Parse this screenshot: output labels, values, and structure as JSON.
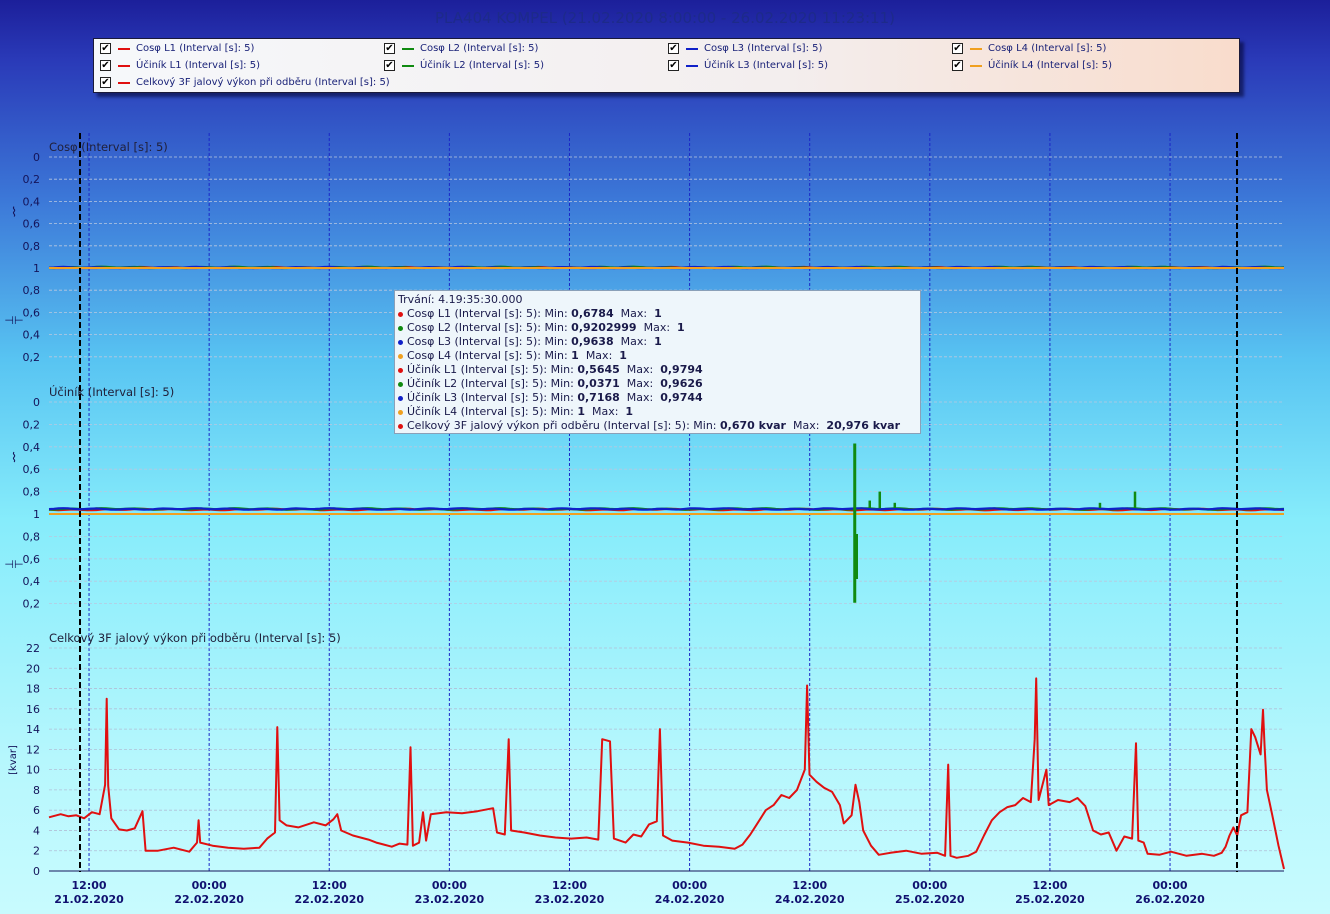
{
  "window_title": "PLA404 KOMPEL (21.02.2020 8:00:00 - 26.02.2020 11:23:11)",
  "legend": [
    {
      "label": "Cosφ L1 (Interval [s]: 5)",
      "color": "#e01010",
      "checked": "✔"
    },
    {
      "label": "Cosφ L2 (Interval [s]: 5)",
      "color": "#108a10",
      "checked": "✔"
    },
    {
      "label": "Cosφ L3 (Interval [s]: 5)",
      "color": "#1020c8",
      "checked": "✔"
    },
    {
      "label": "Cosφ L4 (Interval [s]: 5)",
      "color": "#f0a020",
      "checked": "✔"
    },
    {
      "label": "Účiník L1 (Interval [s]: 5)",
      "color": "#e01010",
      "checked": "✔"
    },
    {
      "label": "Účiník L2 (Interval [s]: 5)",
      "color": "#108a10",
      "checked": "✔"
    },
    {
      "label": "Účiník L3 (Interval [s]: 5)",
      "color": "#1020c8",
      "checked": "✔"
    },
    {
      "label": "Účiník L4 (Interval [s]: 5)",
      "color": "#f0a020",
      "checked": "✔"
    },
    {
      "label": "Celkový 3F jalový výkon při odběru (Interval [s]: 5)",
      "color": "#e01010",
      "checked": "✔"
    }
  ],
  "tooltip": {
    "duration": "Trvání: 4.19:35:30.000",
    "rows": [
      {
        "label": "Cosφ L1 (Interval [s]: 5): Min: ",
        "min": "0,6784",
        "mid": "  Max:  ",
        "max": "1",
        "color": "#e01010"
      },
      {
        "label": "Cosφ L2 (Interval [s]: 5): Min: ",
        "min": "0,9202999",
        "mid": "  Max:  ",
        "max": "1",
        "color": "#108a10"
      },
      {
        "label": "Cosφ L3 (Interval [s]: 5): Min: ",
        "min": "0,9638",
        "mid": "  Max:  ",
        "max": "1",
        "color": "#1020c8"
      },
      {
        "label": "Cosφ L4 (Interval [s]: 5): Min: ",
        "min": "1",
        "mid": "  Max:  ",
        "max": "1",
        "color": "#f0a020"
      },
      {
        "label": "Účiník L1 (Interval [s]: 5): Min: ",
        "min": "0,5645",
        "mid": "  Max:  ",
        "max": "0,9794",
        "color": "#e01010"
      },
      {
        "label": "Účiník L2 (Interval [s]: 5): Min: ",
        "min": "0,0371",
        "mid": "  Max:  ",
        "max": "0,9626",
        "color": "#108a10"
      },
      {
        "label": "Účiník L3 (Interval [s]: 5): Min: ",
        "min": "0,7168",
        "mid": "  Max:  ",
        "max": "0,9744",
        "color": "#1020c8"
      },
      {
        "label": "Účiník L4 (Interval [s]: 5): Min: ",
        "min": "1",
        "mid": "  Max:  ",
        "max": "1",
        "color": "#f0a020"
      },
      {
        "label": "Celkový 3F jalový výkon při odběru (Interval [s]: 5): Min: ",
        "min": "0,670 kvar",
        "mid": "  Max:  ",
        "max": "20,976 kvar",
        "color": "#e01010"
      }
    ]
  },
  "chart_data": [
    {
      "type": "line",
      "title": "Cosφ (Interval [s]: 5)",
      "ylabel_ind": "⌇",
      "ylabel_cap": "⊣⊢",
      "yticks_top": [
        "0",
        "0,2",
        "0,4",
        "0,6",
        "0,8",
        "1"
      ],
      "yticks_bottom": [
        "0,8",
        "0,6",
        "0,4",
        "0,2"
      ],
      "series": [
        {
          "name": "Cosφ L1 (Interval [s]: 5)",
          "color": "#e01010",
          "typical": 0.998,
          "min": 0.6784,
          "max": 1
        },
        {
          "name": "Cosφ L2 (Interval [s]: 5)",
          "color": "#108a10",
          "typical": 0.995,
          "min": 0.9202999,
          "max": 1
        },
        {
          "name": "Cosφ L3 (Interval [s]: 5)",
          "color": "#1020c8",
          "typical": 0.997,
          "min": 0.9638,
          "max": 1
        },
        {
          "name": "Cosφ L4 (Interval [s]: 5)",
          "color": "#f0a020",
          "typical": 1,
          "min": 1,
          "max": 1
        }
      ]
    },
    {
      "type": "line",
      "title": "Účiník (Interval [s]: 5)",
      "ylabel_ind": "⌇",
      "ylabel_cap": "⊣⊢",
      "yticks_top": [
        "0",
        "0,2",
        "0,4",
        "0,6",
        "0,8",
        "1"
      ],
      "yticks_bottom": [
        "0,8",
        "0,6",
        "0,4",
        "0,2"
      ],
      "series": [
        {
          "name": "Účiník L1 (Interval [s]: 5)",
          "color": "#e01010",
          "typical": 0.96,
          "min": 0.5645,
          "max": 0.9794
        },
        {
          "name": "Účiník L2 (Interval [s]: 5)",
          "color": "#108a10",
          "typical": 0.955,
          "min": 0.0371,
          "max": 0.9626
        },
        {
          "name": "Účiník L3 (Interval [s]: 5)",
          "color": "#1020c8",
          "typical": 0.955,
          "min": 0.7168,
          "max": 0.9744
        },
        {
          "name": "Účiník L4 (Interval [s]: 5)",
          "color": "#f0a020",
          "typical": 1,
          "min": 1,
          "max": 1
        }
      ]
    },
    {
      "type": "line",
      "title": "Celkový 3F jalový výkon při odběru (Interval [s]: 5)",
      "ylabel": "[kvar]",
      "ylim": [
        0,
        22
      ],
      "yticks": [
        "0",
        "2",
        "4",
        "6",
        "8",
        "10",
        "12",
        "14",
        "16",
        "18",
        "20",
        "22"
      ],
      "x_start": "21.02.2020 08:00",
      "x_end": "26.02.2020 11:23",
      "xticks": [
        {
          "time": "12:00",
          "date": "21.02.2020"
        },
        {
          "time": "00:00",
          "date": "22.02.2020"
        },
        {
          "time": "12:00",
          "date": "22.02.2020"
        },
        {
          "time": "00:00",
          "date": "23.02.2020"
        },
        {
          "time": "12:00",
          "date": "23.02.2020"
        },
        {
          "time": "00:00",
          "date": "24.02.2020"
        },
        {
          "time": "12:00",
          "date": "24.02.2020"
        },
        {
          "time": "00:00",
          "date": "25.02.2020"
        },
        {
          "time": "12:00",
          "date": "25.02.2020"
        },
        {
          "time": "00:00",
          "date": "26.02.2020"
        }
      ],
      "series": [
        {
          "name": "Celkový 3F jalový výkon při odběru (Interval [s]: 5)",
          "color": "#e01010",
          "points": [
            [
              0,
              5.3
            ],
            [
              1.5,
              5.6
            ],
            [
              2.5,
              5.4
            ],
            [
              3.5,
              5.5
            ],
            [
              4.5,
              5.2
            ],
            [
              5.5,
              5.8
            ],
            [
              6.5,
              5.6
            ],
            [
              7.2,
              8.5
            ],
            [
              7.4,
              17
            ],
            [
              7.6,
              8.4
            ],
            [
              8,
              5.2
            ],
            [
              9,
              4.1
            ],
            [
              10,
              4.0
            ],
            [
              11,
              4.2
            ],
            [
              12,
              5.9
            ],
            [
              12.4,
              2.0
            ],
            [
              14,
              2.0
            ],
            [
              16,
              2.3
            ],
            [
              18,
              1.9
            ],
            [
              19,
              2.8
            ],
            [
              19.2,
              5.0
            ],
            [
              19.4,
              2.8
            ],
            [
              21,
              2.5
            ],
            [
              23,
              2.3
            ],
            [
              25,
              2.2
            ],
            [
              27,
              2.3
            ],
            [
              28,
              3.2
            ],
            [
              29,
              3.8
            ],
            [
              29.3,
              14.2
            ],
            [
              29.6,
              5.0
            ],
            [
              30.5,
              4.5
            ],
            [
              32,
              4.3
            ],
            [
              34,
              4.8
            ],
            [
              35.5,
              4.5
            ],
            [
              36.5,
              5.1
            ],
            [
              37,
              5.6
            ],
            [
              37.5,
              4.0
            ],
            [
              39,
              3.5
            ],
            [
              41,
              3.1
            ],
            [
              42,
              2.8
            ],
            [
              43,
              2.6
            ],
            [
              44,
              2.4
            ],
            [
              45,
              2.7
            ],
            [
              46,
              2.6
            ],
            [
              46.4,
              12.2
            ],
            [
              46.7,
              2.5
            ],
            [
              47.5,
              2.8
            ],
            [
              48,
              5.8
            ],
            [
              48.4,
              3.0
            ],
            [
              49,
              5.6
            ],
            [
              51,
              5.8
            ],
            [
              53,
              5.7
            ],
            [
              55,
              5.9
            ],
            [
              57,
              6.2
            ],
            [
              57.5,
              3.8
            ],
            [
              58.5,
              3.6
            ],
            [
              59,
              13.0
            ],
            [
              59.3,
              4.0
            ],
            [
              61,
              3.8
            ],
            [
              63,
              3.5
            ],
            [
              65,
              3.3
            ],
            [
              67,
              3.2
            ],
            [
              69,
              3.3
            ],
            [
              70.5,
              3.1
            ],
            [
              71,
              13.0
            ],
            [
              72,
              12.8
            ],
            [
              72.5,
              3.2
            ],
            [
              74,
              2.8
            ],
            [
              75,
              3.6
            ],
            [
              76,
              3.4
            ],
            [
              77,
              4.6
            ],
            [
              78,
              4.9
            ],
            [
              78.4,
              14.0
            ],
            [
              78.8,
              3.5
            ],
            [
              80,
              3.0
            ],
            [
              82,
              2.8
            ],
            [
              84,
              2.5
            ],
            [
              86,
              2.4
            ],
            [
              88,
              2.2
            ],
            [
              89,
              2.6
            ],
            [
              90,
              3.6
            ],
            [
              91,
              4.8
            ],
            [
              92,
              6.0
            ],
            [
              93,
              6.5
            ],
            [
              94,
              7.5
            ],
            [
              95,
              7.2
            ],
            [
              96,
              8.0
            ],
            [
              97,
              10.0
            ],
            [
              97.3,
              18.3
            ],
            [
              97.6,
              9.5
            ],
            [
              98.5,
              8.8
            ],
            [
              99.5,
              8.2
            ],
            [
              100.5,
              7.8
            ],
            [
              101.5,
              6.5
            ],
            [
              102,
              4.7
            ],
            [
              103,
              5.5
            ],
            [
              103.5,
              8.5
            ],
            [
              104,
              6.8
            ],
            [
              104.5,
              4.0
            ],
            [
              105.5,
              2.5
            ],
            [
              106.5,
              1.6
            ],
            [
              108,
              1.8
            ],
            [
              110,
              2.0
            ],
            [
              112,
              1.7
            ],
            [
              114,
              1.8
            ],
            [
              115,
              1.5
            ],
            [
              115.4,
              10.5
            ],
            [
              115.7,
              1.5
            ],
            [
              116.5,
              1.3
            ],
            [
              118,
              1.5
            ],
            [
              119,
              1.9
            ],
            [
              120,
              3.5
            ],
            [
              121,
              5.0
            ],
            [
              122,
              5.8
            ],
            [
              123,
              6.3
            ],
            [
              124,
              6.5
            ],
            [
              125,
              7.2
            ],
            [
              126,
              6.8
            ],
            [
              126.5,
              13.0
            ],
            [
              126.7,
              19.0
            ],
            [
              127,
              7.0
            ],
            [
              128,
              10.0
            ],
            [
              128.3,
              6.5
            ],
            [
              129.5,
              7.0
            ],
            [
              131,
              6.8
            ],
            [
              132,
              7.2
            ],
            [
              133,
              6.4
            ],
            [
              134,
              4.0
            ],
            [
              135,
              3.6
            ],
            [
              136,
              3.8
            ],
            [
              137,
              2.0
            ],
            [
              138,
              3.4
            ],
            [
              139,
              3.2
            ],
            [
              139.5,
              12.6
            ],
            [
              139.8,
              3.0
            ],
            [
              140.5,
              2.8
            ],
            [
              141,
              1.7
            ],
            [
              142.5,
              1.6
            ],
            [
              144,
              1.9
            ],
            [
              146,
              1.5
            ],
            [
              148,
              1.7
            ],
            [
              149.5,
              1.5
            ],
            [
              150.5,
              1.8
            ],
            [
              151,
              2.4
            ],
            [
              151.5,
              3.5
            ],
            [
              152,
              4.3
            ],
            [
              152.5,
              3.5
            ],
            [
              153,
              5.5
            ],
            [
              153.8,
              5.8
            ],
            [
              154.3,
              14.0
            ],
            [
              154.8,
              13.2
            ],
            [
              155.5,
              11.5
            ],
            [
              155.8,
              15.9
            ],
            [
              156,
              12.5
            ],
            [
              156.3,
              8.0
            ],
            [
              157,
              5.5
            ],
            [
              157.8,
              2.5
            ],
            [
              158.5,
              0.2
            ]
          ]
        }
      ]
    }
  ]
}
